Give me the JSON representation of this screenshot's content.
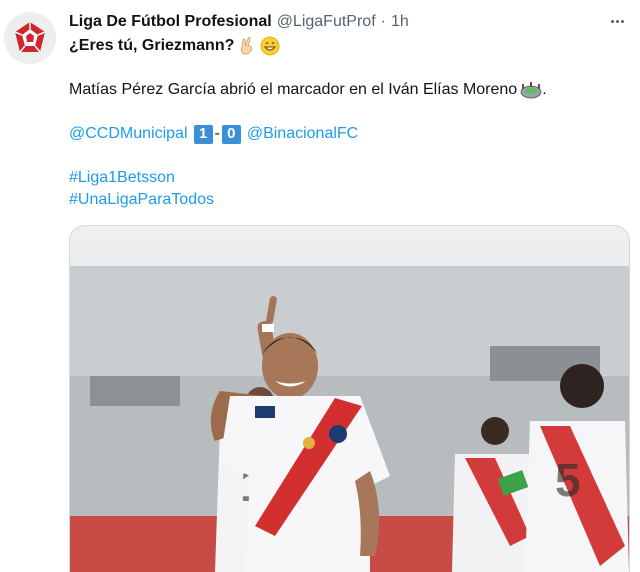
{
  "account": {
    "display_name": "Liga De Fútbol Profesional",
    "handle": "@LigaFutProf",
    "separator": "·",
    "time": "1h"
  },
  "tweet": {
    "line1": "¿Eres tú, Griezmann?",
    "line2": "Matías Pérez García abrió el marcador en el Iván Elías Moreno",
    "line2_end": ".",
    "team_home": "@CCDMunicipal",
    "score_home": "1",
    "score_sep": "-",
    "score_away": "0",
    "team_away": "@BinacionalFC",
    "hashtag1": "#Liga1Betsson",
    "hashtag2": "#UnaLigaParaTodos"
  },
  "icons": {
    "avatar": "liga1-logo-icon",
    "more": "more-options-icon",
    "emoji1": "victory-hand-icon",
    "emoji2": "grinning-face-icon",
    "emoji3": "stadium-icon"
  },
  "colors": {
    "link": "#1d9bf0",
    "secondary": "#536471",
    "logo": "#d1262d",
    "score_box": "#3a8fd6"
  }
}
